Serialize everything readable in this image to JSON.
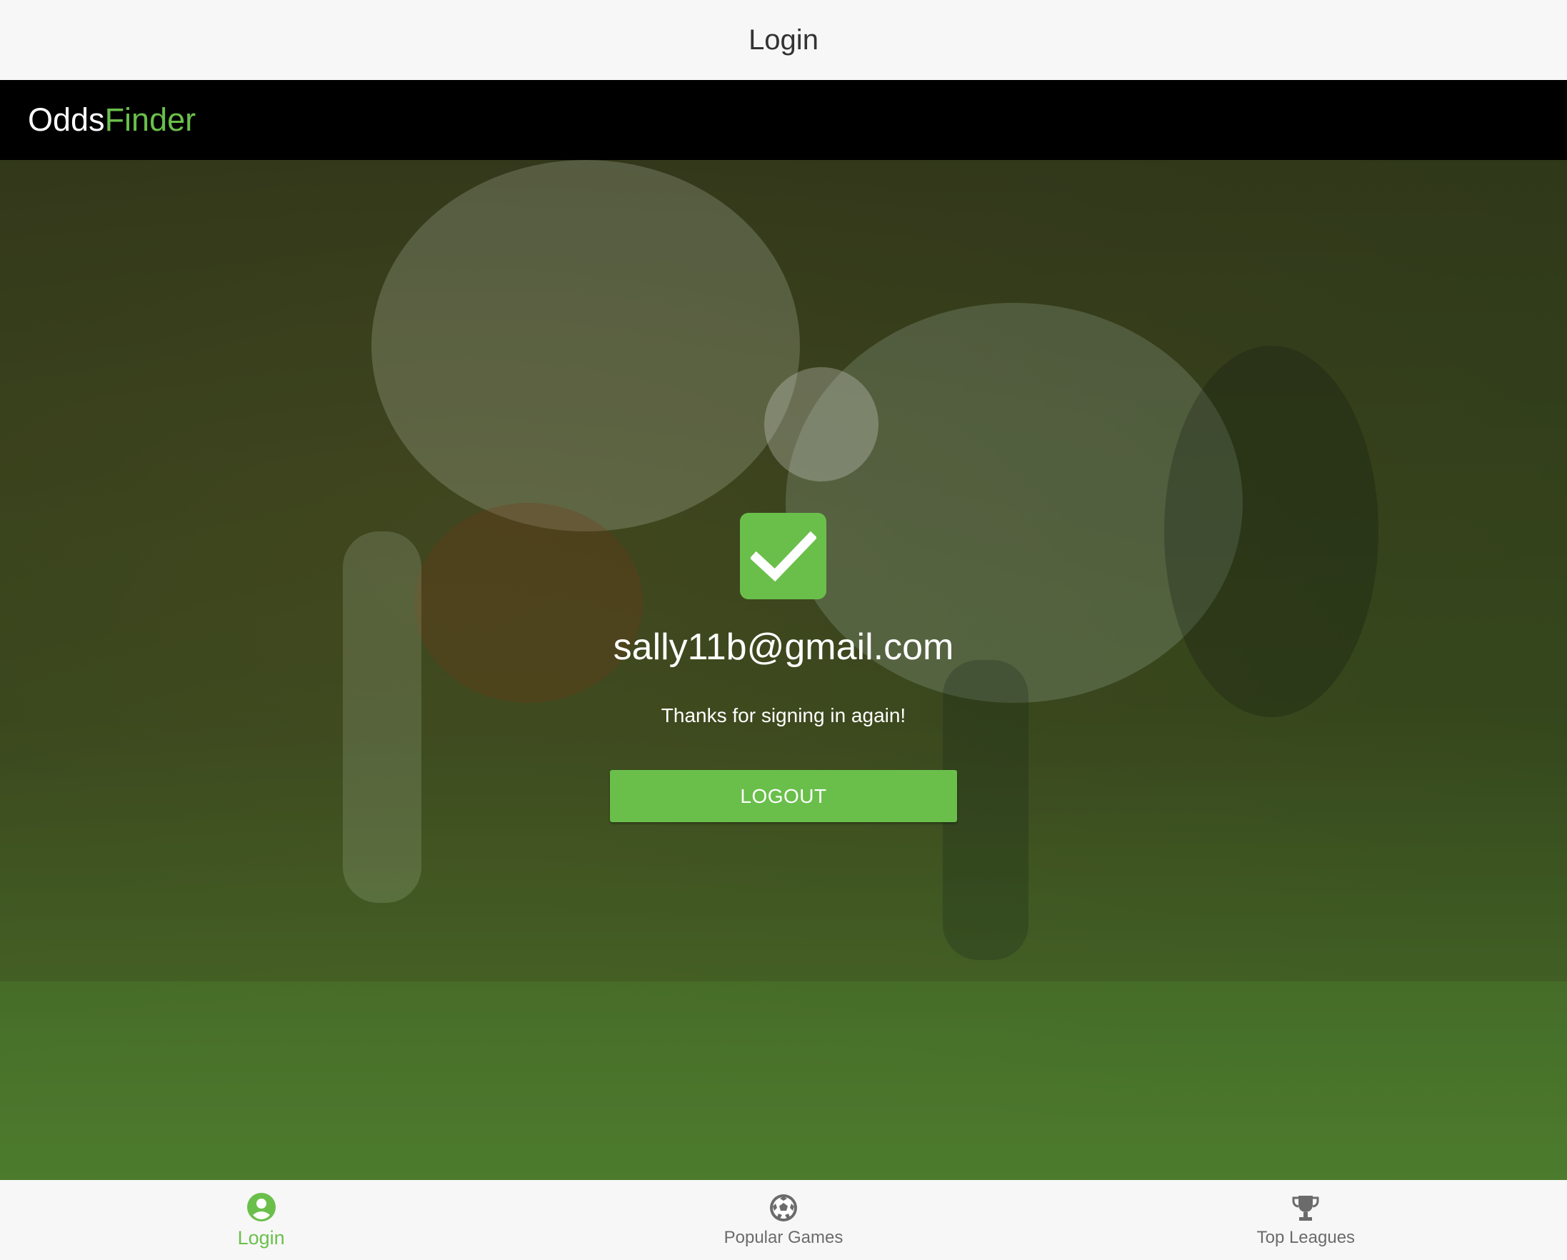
{
  "header": {
    "title": "Login"
  },
  "brand": {
    "part1": "Odds",
    "part2": "Finder"
  },
  "colors": {
    "accent": "#6abf4b",
    "inactive": "#6b6b6b",
    "brand_bar": "#000000"
  },
  "login_status": {
    "icon": "check-icon",
    "email": "sally11b@gmail.com",
    "message": "Thanks for signing in again!",
    "logout_label": "LOGOUT"
  },
  "tabs": [
    {
      "label": "Login",
      "icon": "account-circle-icon",
      "active": true
    },
    {
      "label": "Popular Games",
      "icon": "soccer-ball-icon",
      "active": false
    },
    {
      "label": "Top Leagues",
      "icon": "trophy-icon",
      "active": false
    }
  ]
}
